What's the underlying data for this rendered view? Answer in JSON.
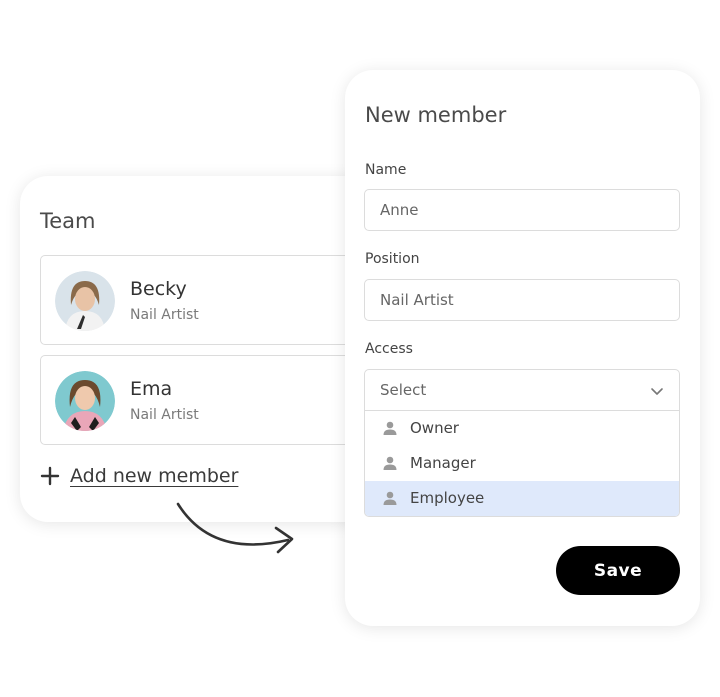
{
  "team": {
    "title": "Team",
    "members": [
      {
        "name": "Becky",
        "role": "Nail Artist"
      },
      {
        "name": "Ema",
        "role": "Nail Artist"
      }
    ],
    "add_label": "Add new member"
  },
  "form": {
    "title": "New member",
    "name_label": "Name",
    "name_value": "Anne",
    "position_label": "Position",
    "position_value": "Nail Artist",
    "access_label": "Access",
    "access_placeholder": "Select",
    "access_options": [
      "Owner",
      "Manager",
      "Employee"
    ],
    "access_highlighted": "Employee",
    "save_label": "Save"
  },
  "colors": {
    "highlight": "#dfe9fb",
    "save_bg": "#000000",
    "border": "#dcdcdc"
  },
  "icons": [
    "plus-icon",
    "curved-arrow-icon",
    "chevron-down-icon",
    "person-icon"
  ]
}
